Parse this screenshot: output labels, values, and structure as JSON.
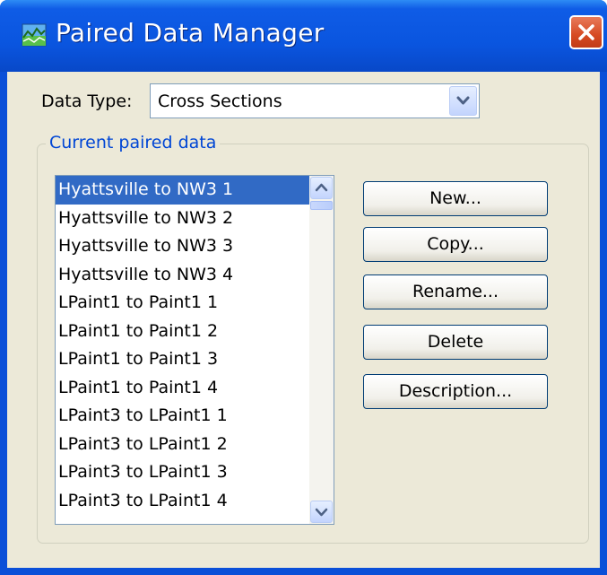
{
  "window": {
    "title": "Paired Data Manager",
    "colors": {
      "titlebar": "#0a55df",
      "client": "#ece9d8",
      "selection": "#316ac5",
      "close": "#d64a22"
    }
  },
  "data_type": {
    "label": "Data Type:",
    "selected": "Cross Sections"
  },
  "group": {
    "legend": "Current paired data"
  },
  "list": {
    "items": [
      "Hyattsville to NW3 1",
      "Hyattsville to NW3 2",
      "Hyattsville to NW3 3",
      "Hyattsville to NW3 4",
      "LPaint1 to Paint1 1",
      "LPaint1 to Paint1 2",
      "LPaint1 to Paint1 3",
      "LPaint1 to Paint1 4",
      "LPaint3 to LPaint1 1",
      "LPaint3 to LPaint1 2",
      "LPaint3 to LPaint1 3",
      "LPaint3 to LPaint1 4"
    ],
    "selected_index": 0
  },
  "buttons": {
    "new": "New...",
    "copy": "Copy...",
    "rename": "Rename...",
    "delete": "Delete",
    "description": "Description..."
  },
  "icons": {
    "app": "paired-data-icon",
    "close": "close-icon",
    "dropdown": "chevron-down-icon",
    "scroll_up": "arrow-up-icon",
    "scroll_down": "arrow-down-icon"
  }
}
